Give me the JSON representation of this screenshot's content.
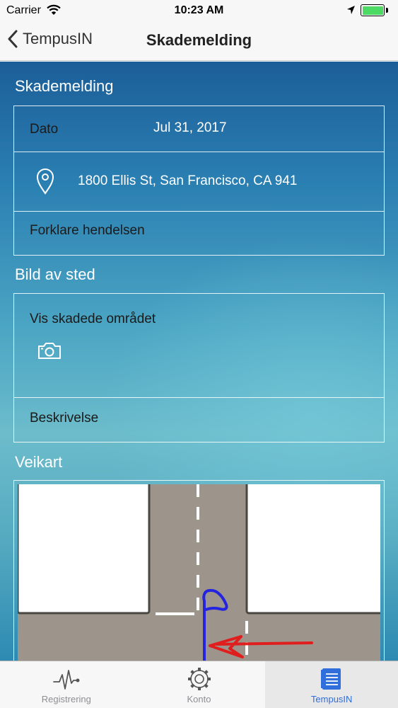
{
  "status_bar": {
    "carrier": "Carrier",
    "time": "10:23 AM",
    "battery_color": "#4cd964"
  },
  "nav": {
    "back_label": "TempusIN",
    "title": "Skademelding"
  },
  "sections": {
    "skademelding_title": "Skademelding",
    "dato_label": "Dato",
    "dato_value": "Jul 31, 2017",
    "location_value": "1800 Ellis St, San Francisco, CA 941",
    "forklare_label": "Forklare hendelsen",
    "bild_title": "Bild av sted",
    "vis_label": "Vis skadede området",
    "beskrivelse_label": "Beskrivelse",
    "veikart_title": "Veikart"
  },
  "tabs": [
    {
      "label": "Registrering",
      "icon": "pulse-icon",
      "active": false
    },
    {
      "label": "Konto",
      "icon": "gear-icon",
      "active": false
    },
    {
      "label": "TempusIN",
      "icon": "document-icon",
      "active": true
    }
  ],
  "colors": {
    "accent": "#2f6edb",
    "drawing_blue": "#2323e0",
    "drawing_red": "#e01e1e",
    "road": "#9d958c"
  }
}
